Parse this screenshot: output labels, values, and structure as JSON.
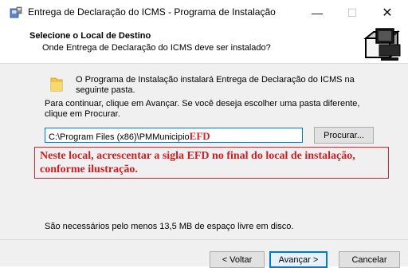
{
  "window": {
    "title": "Entrega de Declaração do ICMS - Programa de Instalação",
    "minimize_glyph": "—",
    "maximize_glyph": "☐",
    "close_glyph": "✕"
  },
  "header": {
    "title": "Selecione o Local de Destino",
    "subtitle": "Onde Entrega de Declaração do ICMS deve ser instalado?"
  },
  "content": {
    "info_message": "O Programa de Instalação instalará Entrega de Declaração do ICMS na seguinte pasta.",
    "instruction": "Para continuar, clique em Avançar. Se você deseja escolher uma pasta diferente, clique em Procurar.",
    "path_value": "C:\\Program Files (x86)\\PMMunicipio",
    "path_suffix": "EFD",
    "browse_label": "Procurar...",
    "annotation": "Neste local, acrescentar a sigla EFD no final do local de instalação, conforme ilustração.",
    "space_note": "São necessários pelo menos 13,5 MB de espaço livre em disco."
  },
  "footer": {
    "back_label": "< Voltar",
    "next_label": "Avançar >",
    "cancel_label": "Cancelar"
  },
  "icons": {
    "app": "installer-icon",
    "header_art": "computer-box-icon",
    "folder": "folder-icon"
  },
  "colors": {
    "accent": "#0078d7",
    "annotation_red": "#d01c24",
    "panel_bg": "#f0f0f0"
  }
}
